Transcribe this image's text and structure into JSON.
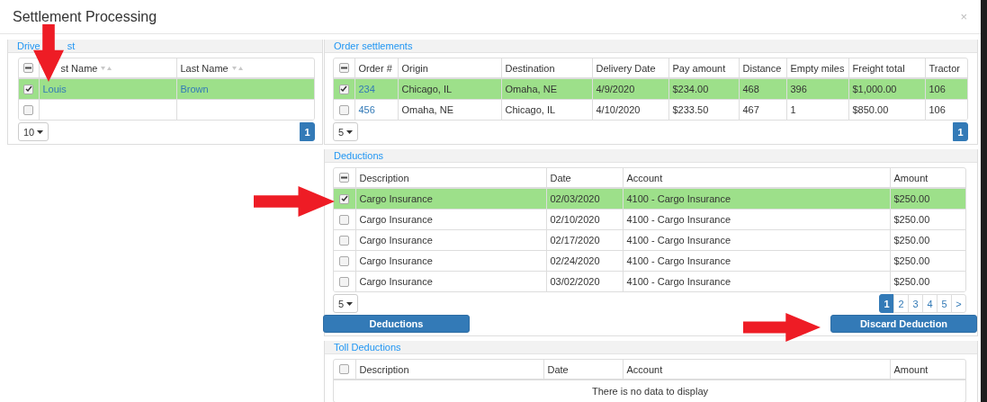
{
  "window": {
    "title": "Settlement Processing",
    "close": "×"
  },
  "driver_list": {
    "title_parts": [
      "Drive",
      "st"
    ],
    "header_mixed": true,
    "columns": [
      {
        "label": "st Name",
        "sortable": true,
        "link": true
      },
      {
        "label": "Last Name",
        "sortable": true,
        "link": true
      }
    ],
    "rows": [
      {
        "selected": true,
        "checked": true,
        "cells": [
          "Louis",
          "Brown"
        ]
      },
      {
        "selected": false,
        "checked": false
      }
    ],
    "page_size": "10",
    "pages": [
      {
        "label": "1",
        "selected": true
      }
    ]
  },
  "order_settlements": {
    "title_parts": [
      "Order settlements"
    ],
    "header_mixed": true,
    "columns": [
      {
        "label": "Order #",
        "link": true
      },
      {
        "label": "Origin"
      },
      {
        "label": "Destination"
      },
      {
        "label": "Delivery Date"
      },
      {
        "label": "Pay amount"
      },
      {
        "label": "Distance"
      },
      {
        "label": "Empty miles"
      },
      {
        "label": "Freight total"
      },
      {
        "label": "Tractor"
      }
    ],
    "rows": [
      {
        "selected": true,
        "checked": true,
        "cells": [
          "234",
          "Chicago, IL",
          "Omaha, NE",
          "4/9/2020",
          "$234.00",
          "468",
          "396",
          "$1,000.00",
          "106"
        ]
      },
      {
        "selected": false,
        "checked": false,
        "cells": [
          "456",
          "Omaha, NE",
          "Chicago, IL",
          "4/10/2020",
          "$233.50",
          "467",
          "1",
          "$850.00",
          "106"
        ]
      }
    ],
    "page_size": "5",
    "pages": [
      {
        "label": "1",
        "selected": true
      }
    ]
  },
  "deductions": {
    "title_parts": [
      "Deductions"
    ],
    "header_mixed": true,
    "columns": [
      {
        "label": "Description"
      },
      {
        "label": "Date"
      },
      {
        "label": "Account"
      },
      {
        "label": "Amount"
      }
    ],
    "rows": [
      {
        "selected": true,
        "checked": true,
        "cells": [
          "Cargo Insurance",
          "02/03/2020",
          "4100 - Cargo Insurance",
          "$250.00"
        ]
      },
      {
        "selected": false,
        "checked": false,
        "cells": [
          "Cargo Insurance",
          "02/10/2020",
          "4100 - Cargo Insurance",
          "$250.00"
        ]
      },
      {
        "selected": false,
        "checked": false,
        "cells": [
          "Cargo Insurance",
          "02/17/2020",
          "4100 - Cargo Insurance",
          "$250.00"
        ]
      },
      {
        "selected": false,
        "checked": false,
        "cells": [
          "Cargo Insurance",
          "02/24/2020",
          "4100 - Cargo Insurance",
          "$250.00"
        ]
      },
      {
        "selected": false,
        "checked": false,
        "cells": [
          "Cargo Insurance",
          "03/02/2020",
          "4100 - Cargo Insurance",
          "$250.00"
        ]
      }
    ],
    "page_size": "5",
    "pages": [
      {
        "label": "1",
        "selected": true
      },
      {
        "label": "2",
        "selected": false
      },
      {
        "label": "3",
        "selected": false
      },
      {
        "label": "4",
        "selected": false
      },
      {
        "label": "5",
        "selected": false
      },
      {
        "label": ">",
        "selected": false
      }
    ],
    "buttons": [
      "Deductions",
      "Discard Deduction"
    ]
  },
  "toll_deductions": {
    "title_parts": [
      "Toll Deductions"
    ],
    "header_mixed": false,
    "columns": [
      {
        "label": "Description"
      },
      {
        "label": "Date"
      },
      {
        "label": "Account"
      },
      {
        "label": "Amount"
      }
    ],
    "empty_message": "There is no data to display"
  },
  "annotations": [
    {
      "kind": "downarrow"
    },
    {
      "kind": "rightarrow"
    },
    {
      "kind": "rightarrow"
    }
  ]
}
